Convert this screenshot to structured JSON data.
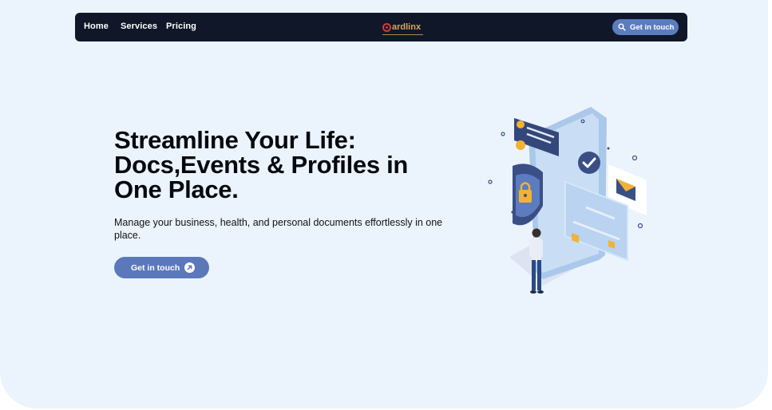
{
  "nav": {
    "links": [
      "Home",
      "Services",
      "Pricing"
    ],
    "logo_text": "ardlinx",
    "cta_label": "Get in touch",
    "cta_icon": "search-icon"
  },
  "hero": {
    "title_lines": [
      "Streamline Your Life:",
      "Docs,Events & Profiles in",
      "One Place."
    ],
    "subtitle": "Manage your business, health, and personal documents effortlessly in one place.",
    "cta_label": "Get in touch",
    "cta_icon": "arrow-up-right-icon"
  },
  "colors": {
    "page_background": "#ebf4fd",
    "navbar": "#0f1728",
    "button": "#5b7cbf",
    "logo": "#d9a85a"
  }
}
